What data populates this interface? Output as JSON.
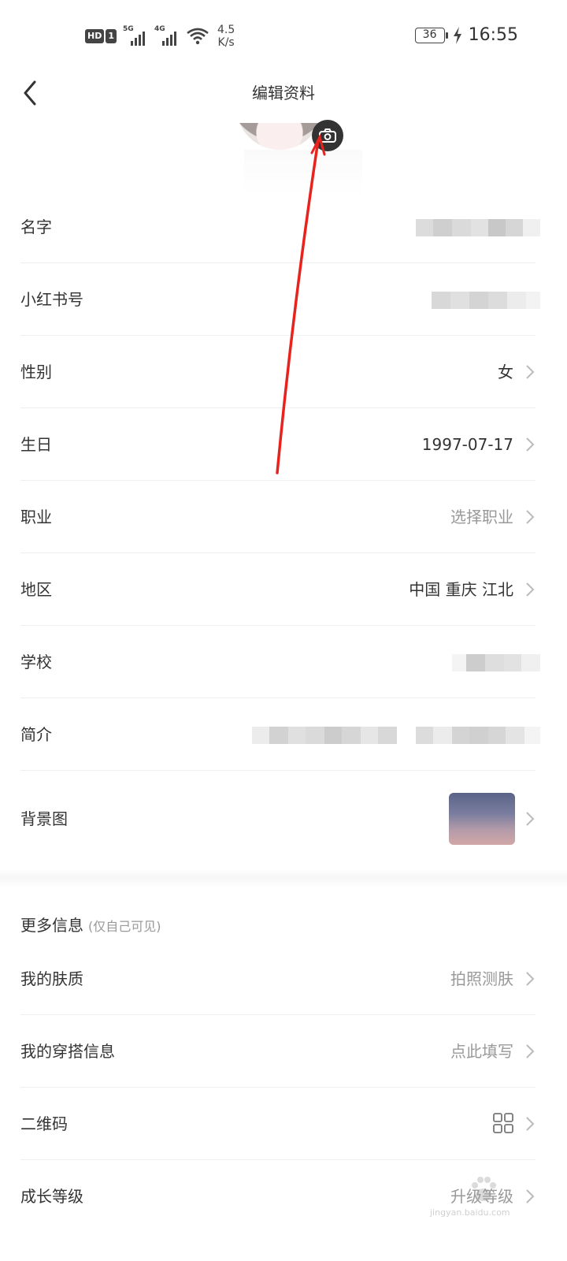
{
  "status_bar": {
    "hd_label": "HD",
    "sim_label": "1",
    "net1_label": "5G",
    "net2_label": "4G",
    "speed_value": "4.5",
    "speed_unit": "K/s",
    "battery": "36",
    "time": "16:55"
  },
  "header": {
    "title": "编辑资料"
  },
  "profile_rows": [
    {
      "label": "名字",
      "value": "",
      "value_style": "redacted",
      "has_chevron": false
    },
    {
      "label": "小红书号",
      "value": "",
      "value_style": "redacted",
      "has_chevron": false
    },
    {
      "label": "性别",
      "value": "女",
      "value_style": "normal",
      "has_chevron": true
    },
    {
      "label": "生日",
      "value": "1997-07-17",
      "value_style": "normal",
      "has_chevron": true
    },
    {
      "label": "职业",
      "value": "选择职业",
      "value_style": "muted",
      "has_chevron": true
    },
    {
      "label": "地区",
      "value": "中国 重庆 江北",
      "value_style": "normal",
      "has_chevron": true
    },
    {
      "label": "学校",
      "value": "",
      "value_style": "redacted",
      "has_chevron": false
    },
    {
      "label": "简介",
      "value": "",
      "value_style": "redacted",
      "has_chevron": false
    },
    {
      "label": "背景图",
      "value": "",
      "value_style": "image",
      "has_chevron": true
    }
  ],
  "more_info": {
    "title": "更多信息",
    "subtitle": "(仅自己可见)",
    "rows": [
      {
        "label": "我的肤质",
        "value": "拍照测肤",
        "value_style": "muted",
        "has_chevron": true
      },
      {
        "label": "我的穿搭信息",
        "value": "点此填写",
        "value_style": "muted",
        "has_chevron": true
      },
      {
        "label": "二维码",
        "value": "",
        "value_style": "qr-icon",
        "has_chevron": true
      },
      {
        "label": "成长等级",
        "value": "升级等级",
        "value_style": "muted",
        "has_chevron": true
      }
    ]
  },
  "watermark": {
    "text": "jingyan.baidu.com"
  },
  "colors": {
    "annotation_arrow": "#e8231e",
    "divider": "#efefef",
    "muted_text": "#999999"
  }
}
